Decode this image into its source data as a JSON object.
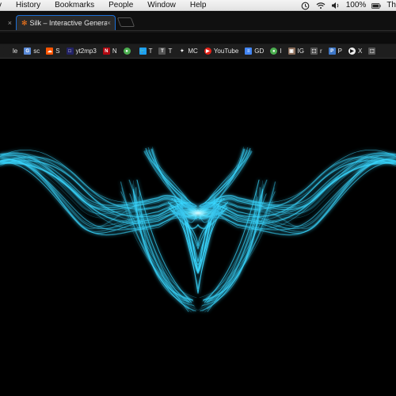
{
  "menubar": {
    "items": [
      "v",
      "History",
      "Bookmarks",
      "People",
      "Window",
      "Help"
    ],
    "battery": "100%",
    "clock": "Th"
  },
  "tabs": {
    "active_title": "Silk – Interactive Generative Art",
    "active_close": "×",
    "prev_close": "×"
  },
  "bookmarks": [
    {
      "label": "le",
      "icon_color": "#1e1e1e",
      "icon_text": ""
    },
    {
      "label": "sc",
      "icon_color": "#5a8ad8",
      "icon_text": "G"
    },
    {
      "label": "S",
      "icon_color": "#ff5500",
      "icon_text": "☁"
    },
    {
      "label": "yt2mp3",
      "icon_color": "#222266",
      "icon_text": "□"
    },
    {
      "label": "N",
      "icon_color": "#b20710",
      "icon_text": "N"
    },
    {
      "label": "",
      "icon_color": "#4caf50",
      "icon_text": "●"
    },
    {
      "label": "T",
      "icon_color": "#1da1f2",
      "icon_text": "🐦"
    },
    {
      "label": "T",
      "icon_color": "#555555",
      "icon_text": "T"
    },
    {
      "label": "MC",
      "icon_color": "#1e1e1e",
      "icon_text": "✦"
    },
    {
      "label": "YouTube",
      "icon_color": "#e62117",
      "icon_text": "▶"
    },
    {
      "label": "GD",
      "icon_color": "#4285f4",
      "icon_text": "≡"
    },
    {
      "label": "I",
      "icon_color": "#4caf50",
      "icon_text": "●"
    },
    {
      "label": "IG",
      "icon_color": "#8a6d5a",
      "icon_text": "▣"
    },
    {
      "label": "r",
      "icon_color": "#555555",
      "icon_text": "⬚"
    },
    {
      "label": "P",
      "icon_color": "#3f78c8",
      "icon_text": "P"
    },
    {
      "label": "X",
      "icon_color": "#eeeeee",
      "icon_text": "▶"
    },
    {
      "label": "",
      "icon_color": "#555555",
      "icon_text": "⬚"
    }
  ],
  "artwork": {
    "subject": "silk-glow-pattern",
    "glow_color": "#39d7ff"
  }
}
